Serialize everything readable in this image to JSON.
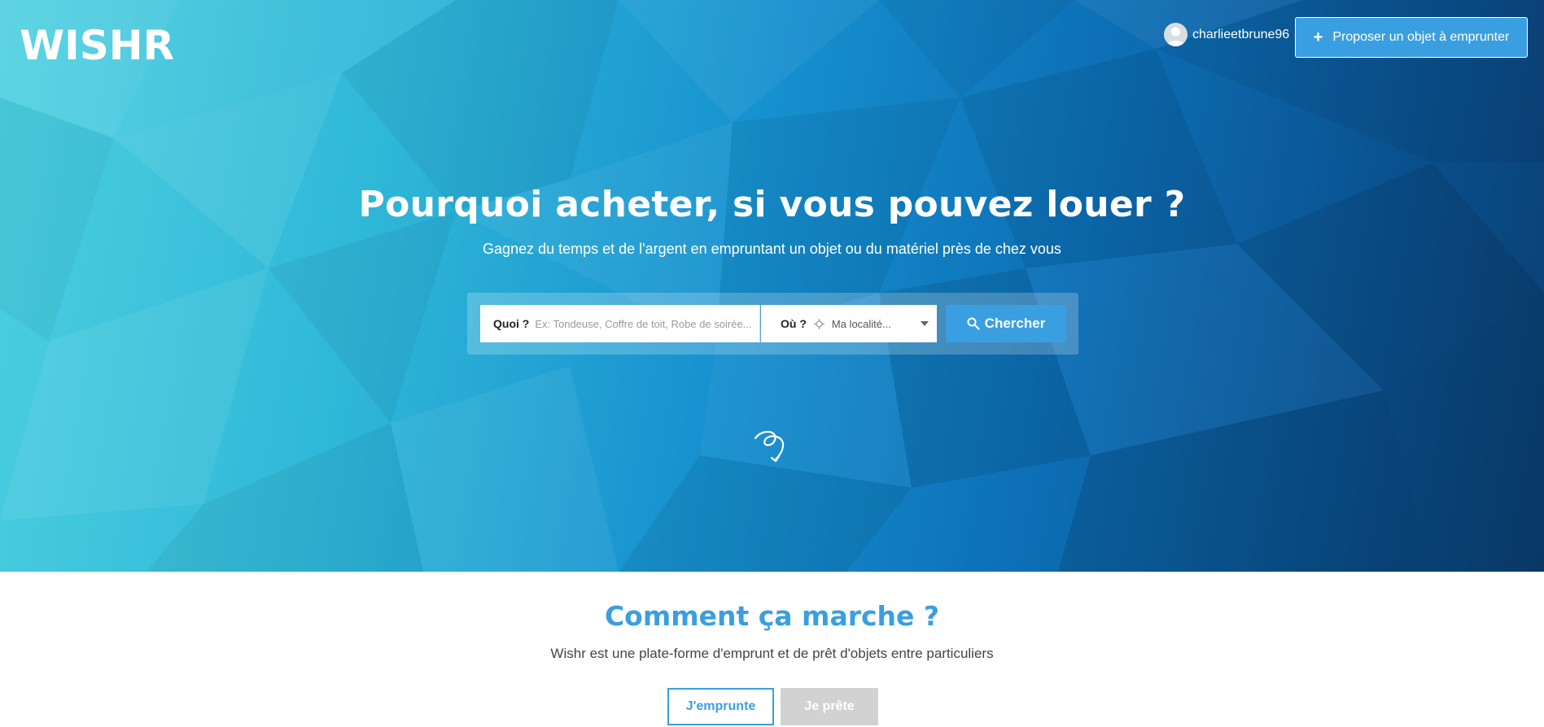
{
  "header": {
    "logo_text": "WISHR",
    "username": "charlieetbrune96",
    "propose_button": "Proposer un objet à emprunter"
  },
  "hero": {
    "headline": "Pourquoi acheter, si vous pouvez louer ?",
    "subline": "Gagnez du temps et de l'argent en empruntant un objet ou du matériel près de chez vous"
  },
  "search": {
    "what_label": "Quoi ?",
    "what_placeholder": "Ex: Tondeuse, Coffre de toit, Robe de soirée...",
    "where_label": "Où ?",
    "where_value": "Ma localité...",
    "button": "Chercher"
  },
  "how": {
    "title": "Comment ça marche ?",
    "subtitle": "Wishr est une plate-forme d'emprunt et de prêt d'objets entre particuliers",
    "borrow_button": "J'emprunte",
    "lend_button": "Je prête"
  },
  "colors": {
    "accent": "#3a9fe0",
    "lend_inactive": "#d2d2d2"
  }
}
